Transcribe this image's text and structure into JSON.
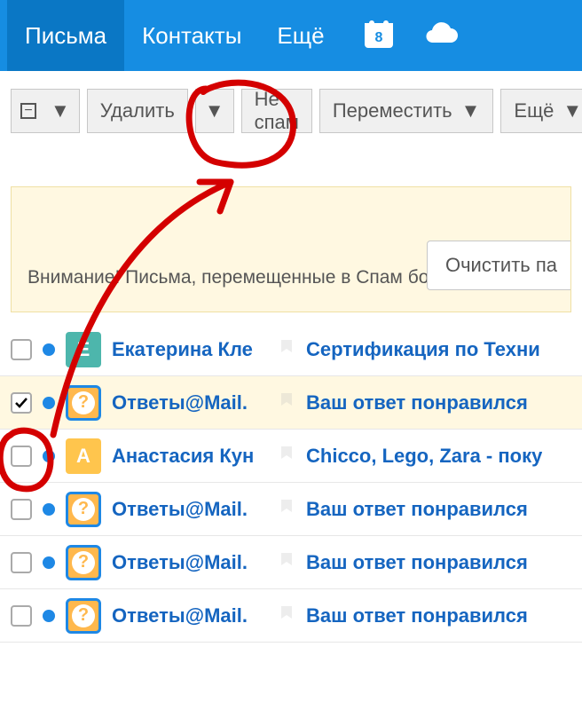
{
  "nav": {
    "items": [
      {
        "label": "Письма",
        "active": true
      },
      {
        "label": "Контакты",
        "active": false
      },
      {
        "label": "Ещё",
        "active": false
      }
    ],
    "calendar_day": "8"
  },
  "toolbar": {
    "delete_label": "Удалить",
    "not_spam_label": "Не спам",
    "move_label": "Переместить",
    "more_label": "Ещё"
  },
  "notice": {
    "clean_label": "Очистить па",
    "text": "Внимание! Письма, перемещенные в Спам более месяца"
  },
  "emails": [
    {
      "checked": false,
      "unread": true,
      "avatar": {
        "type": "letter",
        "char": "Е",
        "cls": "av-teal"
      },
      "sender": "Екатерина Кле",
      "subject": "Сертификация по Техни"
    },
    {
      "checked": true,
      "unread": true,
      "avatar": {
        "type": "q"
      },
      "sender": "Ответы@Mail.",
      "subject": "Ваш ответ понравился"
    },
    {
      "checked": false,
      "unread": true,
      "avatar": {
        "type": "letter",
        "char": "А",
        "cls": "av-amber"
      },
      "sender": "Анастасия Кун",
      "subject": "Chicco, Lego, Zara - поку"
    },
    {
      "checked": false,
      "unread": true,
      "avatar": {
        "type": "q"
      },
      "sender": "Ответы@Mail.",
      "subject": "Ваш ответ понравился"
    },
    {
      "checked": false,
      "unread": true,
      "avatar": {
        "type": "q"
      },
      "sender": "Ответы@Mail.",
      "subject": "Ваш ответ понравился"
    },
    {
      "checked": false,
      "unread": true,
      "avatar": {
        "type": "q"
      },
      "sender": "Ответы@Mail.",
      "subject": "Ваш ответ понравился"
    }
  ]
}
